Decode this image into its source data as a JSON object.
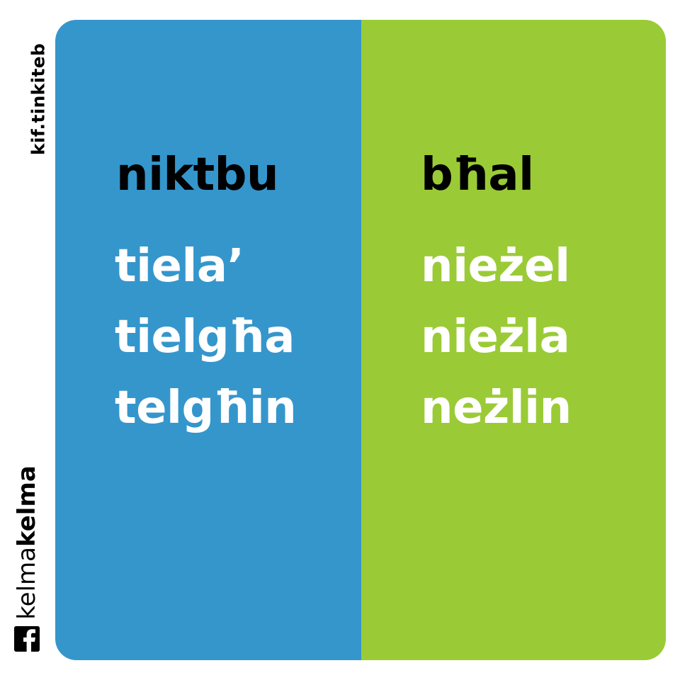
{
  "side": {
    "handle": "kif.tinkiteb",
    "brand_light": "kelma",
    "brand_bold": "kelma",
    "social_icon": "facebook-icon"
  },
  "left_panel": {
    "color": "#3596cc",
    "heading": "niktbu",
    "words": [
      "tiela’",
      "tielgħa",
      "telgħin"
    ]
  },
  "right_panel": {
    "color": "#9acb36",
    "heading": "bħal",
    "words": [
      "nieżel",
      "nieżla",
      "neżlin"
    ]
  }
}
